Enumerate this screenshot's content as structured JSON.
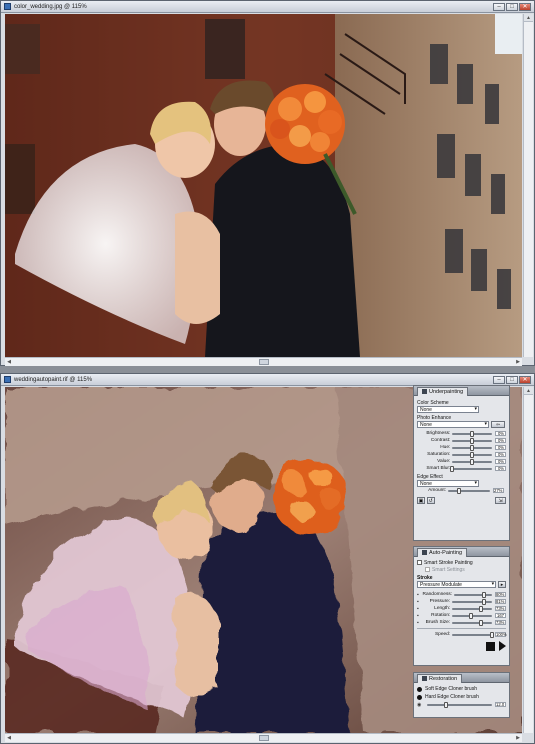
{
  "windows": [
    {
      "title": "color_wedding.jpg @ 115%"
    },
    {
      "title": "weddingautopaint.rif @ 115%"
    }
  ],
  "window_buttons": {
    "minimize": "–",
    "maximize": "□",
    "close": "✕"
  },
  "underpainting": {
    "tab": "Underpainting",
    "color_scheme_label": "Color Scheme",
    "color_scheme_value": "None",
    "photo_enhance_label": "Photo Enhance",
    "photo_enhance_value": "None",
    "sliders": [
      {
        "name": "Brightness:",
        "value": "0%",
        "pos": 0.5
      },
      {
        "name": "Contrast:",
        "value": "0%",
        "pos": 0.5
      },
      {
        "name": "Hue:",
        "value": "0%",
        "pos": 0.5
      },
      {
        "name": "Saturation:",
        "value": "0%",
        "pos": 0.5
      },
      {
        "name": "Value:",
        "value": "0%",
        "pos": 0.5
      },
      {
        "name": "Smart Blur:",
        "value": "0%",
        "pos": 0.0
      }
    ],
    "edge_effect_label": "Edge Effect",
    "edge_effect_value": "None",
    "amount_label": "Amount:",
    "amount_value": "27%",
    "amount_pos": 0.27
  },
  "autopainting": {
    "tab": "Auto-Painting",
    "smart_stroke": "Smart Stroke Painting",
    "smart_settings": "Smart Settings",
    "stroke_label": "Stroke",
    "stroke_value": "Pressure Modulate",
    "sliders": [
      {
        "name": "Randomness:",
        "value": "80%",
        "pos": 0.8
      },
      {
        "name": "Pressure:",
        "value": "81%",
        "pos": 0.81
      },
      {
        "name": "Length:",
        "value": "73%",
        "pos": 0.73
      },
      {
        "name": "Rotation:",
        "value": "167",
        "pos": 0.46
      },
      {
        "name": "Brush Size:",
        "value": "73%",
        "pos": 0.73
      }
    ],
    "speed_label": "Speed:",
    "speed_value": "100%",
    "speed_pos": 1.0
  },
  "restoration": {
    "tab": "Restoration",
    "items": [
      "Soft Edge Cloner brush",
      "Hard Edge Cloner brush"
    ],
    "size_value": "12.0",
    "size_pos": 0.3
  }
}
